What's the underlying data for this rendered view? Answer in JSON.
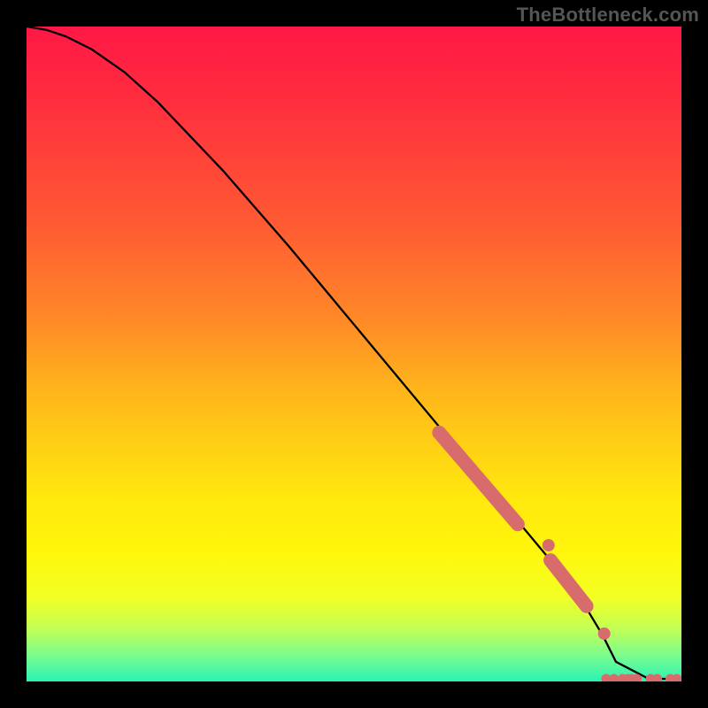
{
  "watermark": "TheBottleneck.com",
  "chart_data": {
    "type": "line",
    "title": "",
    "xlabel": "",
    "ylabel": "",
    "xlim": [
      0,
      100
    ],
    "ylim": [
      0,
      100
    ],
    "series": [
      {
        "name": "curve",
        "x": [
          0,
          3,
          6,
          10,
          15,
          20,
          30,
          40,
          50,
          60,
          70,
          80,
          85,
          88,
          90,
          95,
          100
        ],
        "y": [
          100,
          99.5,
          98.5,
          96.5,
          93,
          88.5,
          78,
          66.5,
          54.5,
          42.5,
          30.5,
          18.5,
          12,
          7,
          3,
          0.4,
          0.4
        ]
      }
    ],
    "marker_bands": [
      {
        "x0": 63,
        "y0": 38,
        "x1": 75,
        "y1": 24,
        "width": 11
      },
      {
        "x0": 80,
        "y0": 18.5,
        "x1": 85.5,
        "y1": 11.5,
        "width": 11
      },
      {
        "x0": 79.7,
        "y0": 20.8,
        "r": 4.5
      },
      {
        "x0": 88.2,
        "y0": 7.3,
        "r": 4.5
      }
    ],
    "bottom_markers_x": [
      88.5,
      89.7,
      91,
      91.8,
      92.4,
      93.2,
      95.3,
      96.3,
      98.3,
      99.3
    ],
    "bottom_marker_y": 0.4,
    "colors": {
      "curve": "#000000",
      "markers": "#d86c6c",
      "gradient_top": "#ff1846",
      "gradient_bottom": "#29f3b3"
    }
  }
}
